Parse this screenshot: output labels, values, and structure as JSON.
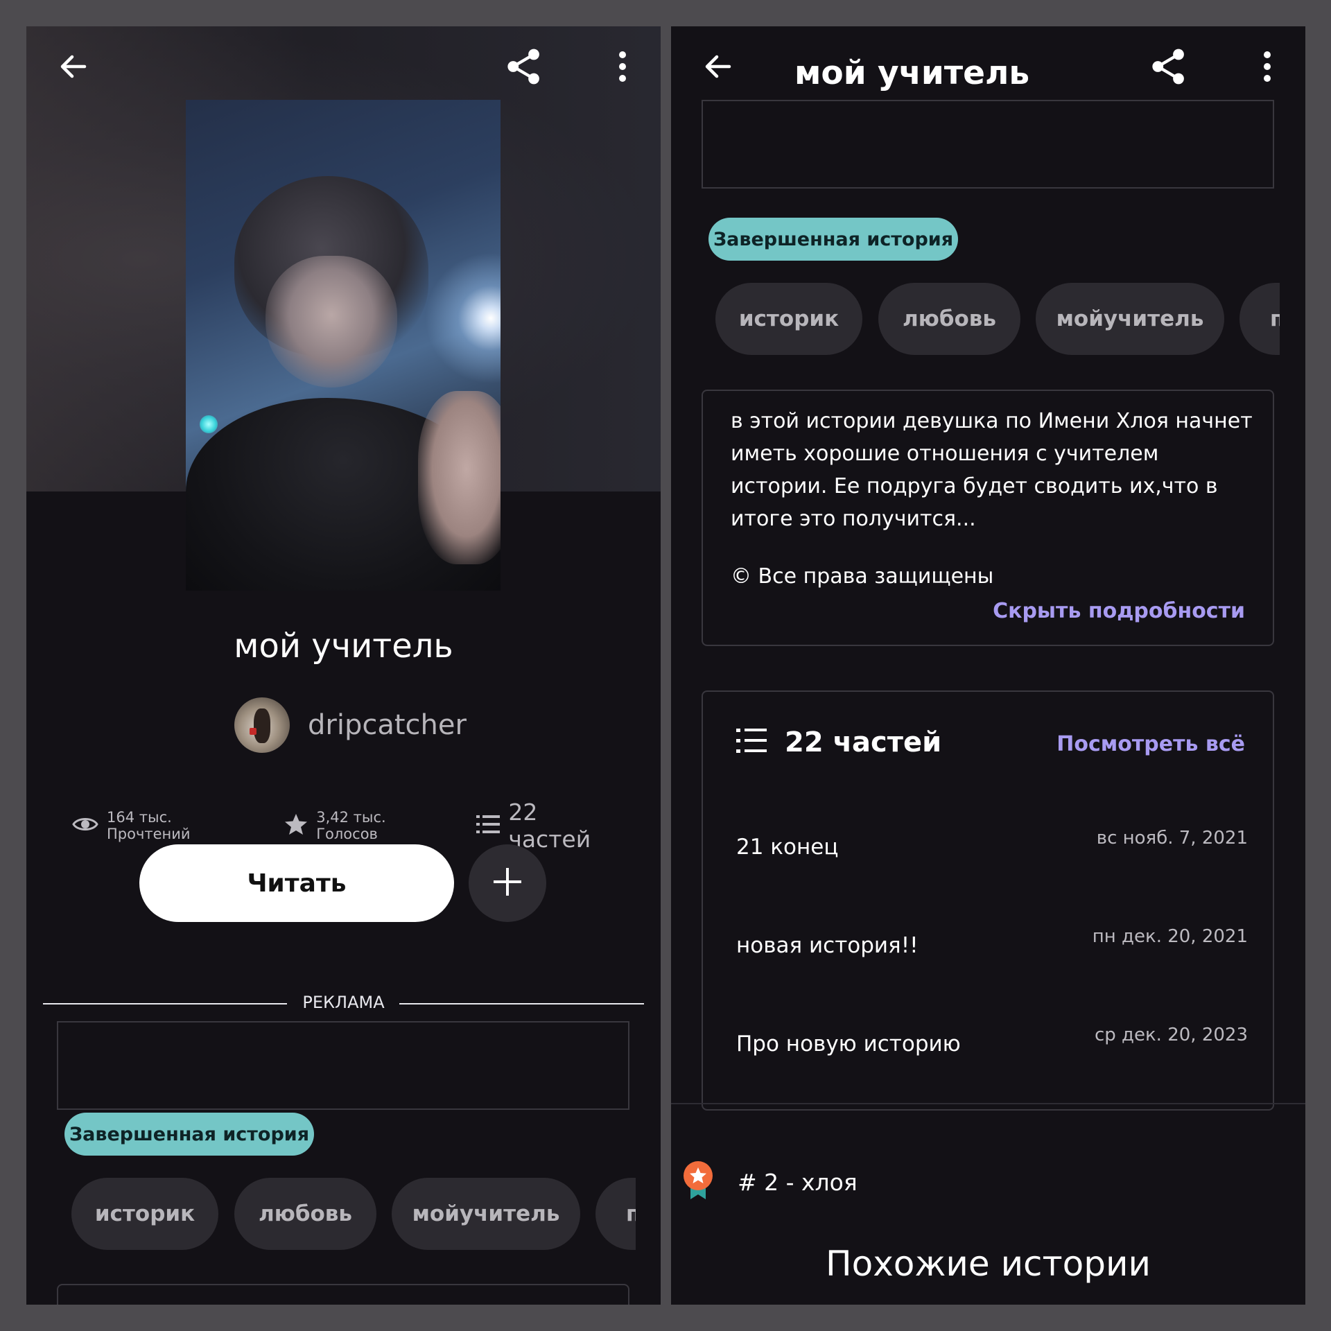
{
  "left": {
    "title": "мой учитель",
    "author": "dripcatcher",
    "stats": {
      "reads": "164 тыс. Прочтений",
      "votes": "3,42 тыс. Голосов",
      "parts": "22 частей"
    },
    "read_button": "Читать",
    "ad_label": "РЕКЛАМА",
    "status_badge": "Завершенная история",
    "tags": [
      "историк",
      "любовь",
      "мойучитель",
      "п"
    ]
  },
  "right": {
    "header_title": "мой учитель",
    "status_badge": "Завершенная история",
    "tags": [
      "историк",
      "любовь",
      "мойучитель",
      "п"
    ],
    "description": "в этой истории девушка по Имени Хлоя начнет иметь хорошие отношения с учителем истории. Ее подруга будет сводить их,что в итоге это получится...",
    "copyright": "© Все права защищены",
    "hide_details": "Скрыть подробности",
    "parts_count": "22 частей",
    "see_all": "Посмотреть всё",
    "parts": [
      {
        "title": "21 конец",
        "date": "вс нояб. 7, 2021"
      },
      {
        "title": "новая история!!",
        "date": "пн дек. 20, 2021"
      },
      {
        "title": "Про новую историю",
        "date": "ср дек. 20, 2023"
      }
    ],
    "rank": "# 2 - хлоя",
    "similar_heading": "Похожие истории"
  },
  "icons": {
    "back": "back-arrow-icon",
    "share": "share-icon",
    "more": "more-vertical-icon",
    "eye": "eye-icon",
    "star": "star-icon",
    "list": "list-icon",
    "plus": "plus-icon",
    "ribbon": "ribbon-badge-icon"
  },
  "colors": {
    "background": "#131116",
    "badge": "#74c6c6",
    "tag": "#2c2a30",
    "link": "#a89bf1",
    "ribbon": "#f26c3b"
  }
}
